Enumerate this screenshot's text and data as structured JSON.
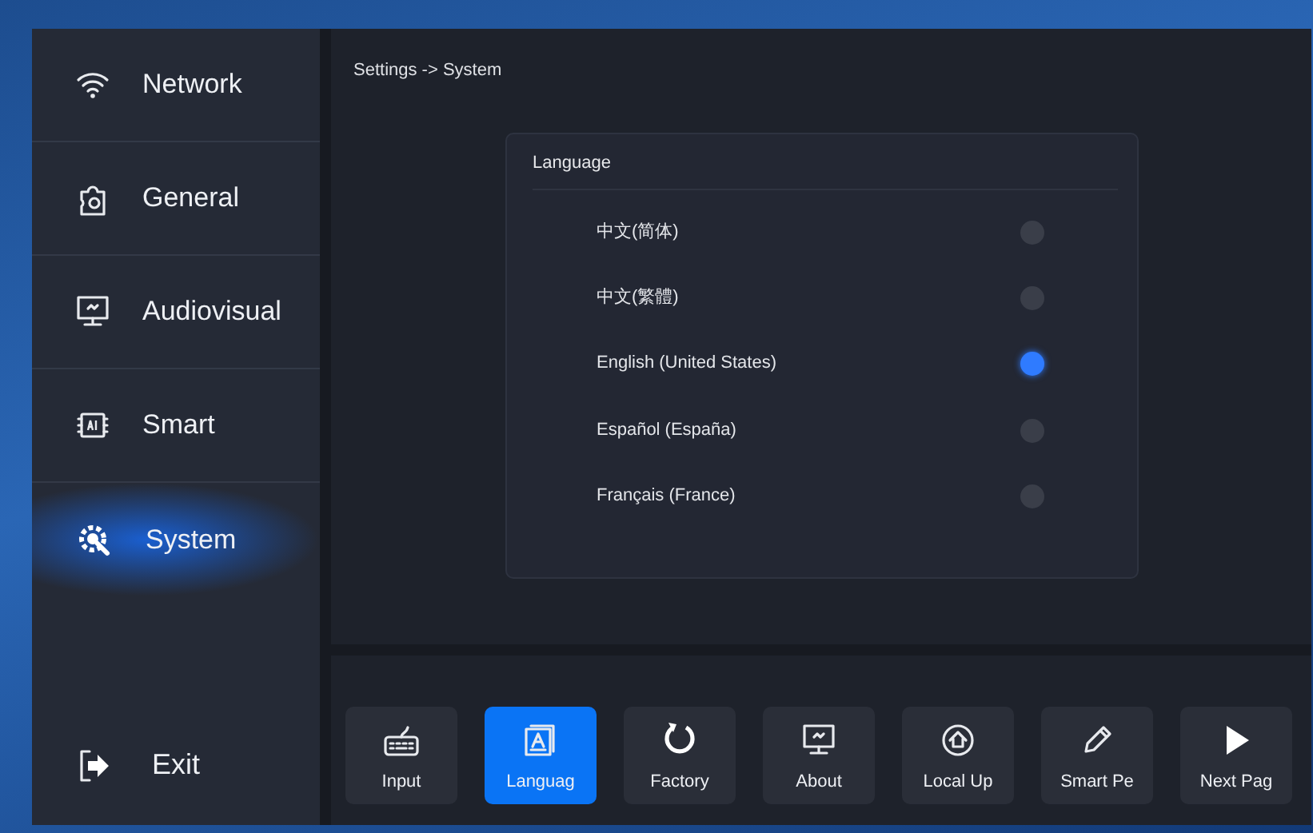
{
  "sidebar": {
    "items": [
      {
        "label": "Network",
        "selected": false
      },
      {
        "label": "General",
        "selected": false
      },
      {
        "label": "Audiovisual",
        "selected": false
      },
      {
        "label": "Smart",
        "selected": false
      },
      {
        "label": "System",
        "selected": true
      }
    ],
    "exit": {
      "label": "Exit"
    }
  },
  "breadcrumb": "Settings -> System",
  "language_panel": {
    "title": "Language",
    "options": [
      {
        "label": "中文(简体)",
        "selected": false
      },
      {
        "label": "中文(繁體)",
        "selected": false
      },
      {
        "label": "English (United States)",
        "selected": true
      },
      {
        "label": "Español (España)",
        "selected": false
      },
      {
        "label": "Français (France)",
        "selected": false
      }
    ]
  },
  "toolbar": [
    {
      "label": "Input",
      "selected": false
    },
    {
      "label": "Languag",
      "selected": true
    },
    {
      "label": "Factory",
      "selected": false
    },
    {
      "label": "About",
      "selected": false
    },
    {
      "label": "Local Up",
      "selected": false
    },
    {
      "label": "Smart Pe",
      "selected": false
    },
    {
      "label": "Next Pag",
      "selected": false
    }
  ]
}
